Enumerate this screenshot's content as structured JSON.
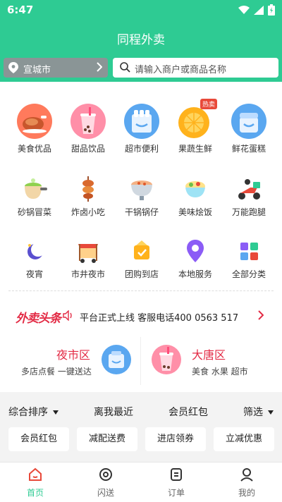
{
  "status": {
    "time": "6:47"
  },
  "header": {
    "title": "同程外卖",
    "city": "宣城市",
    "search_placeholder": "请输入商户或商品名称"
  },
  "colors": {
    "brand": "#2ecb93",
    "accent_red": "#e32b45"
  },
  "categories": [
    {
      "label": "美食优品",
      "icon": "roast-chicken-icon"
    },
    {
      "label": "甜品饮品",
      "icon": "bubble-tea-icon"
    },
    {
      "label": "超市便利",
      "icon": "supermarket-icon"
    },
    {
      "label": "果蔬生鲜",
      "icon": "orange-fruit-icon",
      "badge": "热卖"
    },
    {
      "label": "鲜花蛋糕",
      "icon": "cake-icon"
    },
    {
      "label": "砂锅冒菜",
      "icon": "clay-pot-icon"
    },
    {
      "label": "炸卤小吃",
      "icon": "skewer-icon"
    },
    {
      "label": "干锅锅仔",
      "icon": "dry-pot-icon"
    },
    {
      "label": "美味烩饭",
      "icon": "rice-bowl-icon"
    },
    {
      "label": "万能跑腿",
      "icon": "delivery-scooter-icon"
    },
    {
      "label": "夜宵",
      "icon": "moon-icon"
    },
    {
      "label": "市井夜市",
      "icon": "market-stall-icon"
    },
    {
      "label": "团购到店",
      "icon": "group-buy-icon"
    },
    {
      "label": "本地服务",
      "icon": "location-pin-icon"
    },
    {
      "label": "全部分类",
      "icon": "grid-icon"
    }
  ],
  "notice": {
    "brand": "外卖头条",
    "message": "平台正式上线 客服电话400 0563 517"
  },
  "promos": [
    {
      "title": "夜市区",
      "subtitle": "多店点餐 一键送达",
      "icon": "shopping-bag-icon"
    },
    {
      "title": "大唐区",
      "subtitle": "美食 水果 超市",
      "icon": "bubble-tea-icon"
    }
  ],
  "sort": {
    "items": [
      "综合排序",
      "离我最近",
      "会员红包",
      "筛选"
    ]
  },
  "filters": [
    "会员红包",
    "减配送费",
    "进店领券",
    "立减优惠"
  ],
  "tabs": [
    {
      "label": "首页",
      "active": true
    },
    {
      "label": "闪送",
      "active": false
    },
    {
      "label": "订单",
      "active": false
    },
    {
      "label": "我的",
      "active": false
    }
  ]
}
